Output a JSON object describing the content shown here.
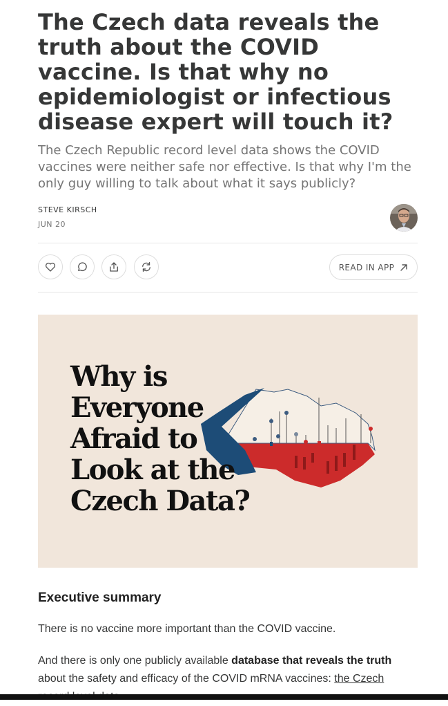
{
  "post": {
    "title": "The Czech data reveals the truth about the COVID vaccine. Is that why no epidemiologist or infectious disease expert will touch it?",
    "subtitle": "The Czech Republic record level data shows the COVID vaccines were neither safe nor effective. Is that why I'm the only guy willing to talk about what it says publicly?",
    "author": "STEVE KIRSCH",
    "date": "JUN 20"
  },
  "actions": {
    "like_icon": "heart-icon",
    "comment_icon": "comment-icon",
    "share_icon": "share-icon",
    "restack_icon": "restack-icon",
    "read_in_app": "READ IN APP",
    "read_in_app_icon": "arrow-up-right-icon"
  },
  "hero": {
    "lines": [
      "Why is",
      "Everyone",
      "Afraid to",
      "Look at the",
      "Czech Data?"
    ],
    "colors": {
      "background": "#f1e6db",
      "blue": "#1d4c77",
      "red": "#cc2b2b"
    }
  },
  "body": {
    "heading": "Executive summary",
    "p1": "There is no vaccine more important than the COVID vaccine.",
    "p2_pre": "And there is only one publicly available ",
    "p2_bold": "database that reveals the truth",
    "p2_post": " about the safety and efficacy of the COVID mRNA vaccines: ",
    "p2_link": "the Czech",
    "p2_cut": "record level data"
  }
}
